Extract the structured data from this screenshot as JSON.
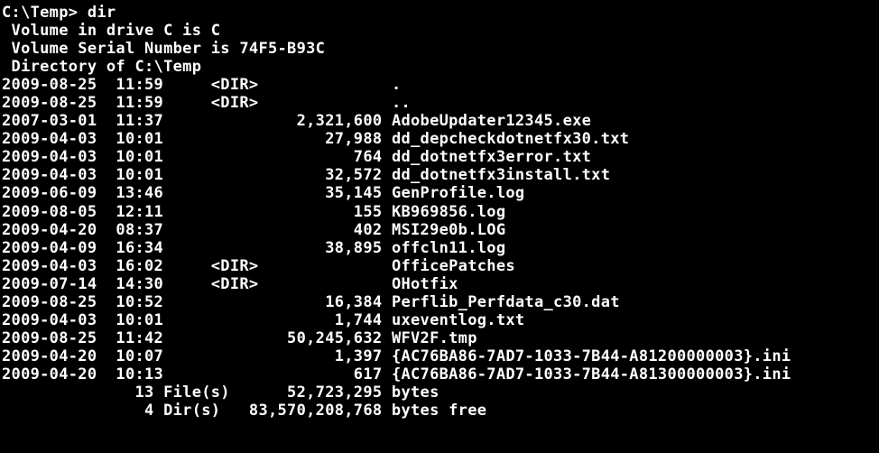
{
  "prompt": "C:\\Temp> dir",
  "vol_line": " Volume in drive C is C",
  "serial_line": " Volume Serial Number is 74F5-B93C",
  "dir_of_line": " Directory of C:\\Temp",
  "entries": [
    {
      "date": "2009-08-25",
      "time": "11:59",
      "dir": true,
      "size": "",
      "name": "."
    },
    {
      "date": "2009-08-25",
      "time": "11:59",
      "dir": true,
      "size": "",
      "name": ".."
    },
    {
      "date": "2007-03-01",
      "time": "11:37",
      "dir": false,
      "size": "2,321,600",
      "name": "AdobeUpdater12345.exe"
    },
    {
      "date": "2009-04-03",
      "time": "10:01",
      "dir": false,
      "size": "27,988",
      "name": "dd_depcheckdotnetfx30.txt"
    },
    {
      "date": "2009-04-03",
      "time": "10:01",
      "dir": false,
      "size": "764",
      "name": "dd_dotnetfx3error.txt"
    },
    {
      "date": "2009-04-03",
      "time": "10:01",
      "dir": false,
      "size": "32,572",
      "name": "dd_dotnetfx3install.txt"
    },
    {
      "date": "2009-06-09",
      "time": "13:46",
      "dir": false,
      "size": "35,145",
      "name": "GenProfile.log"
    },
    {
      "date": "2009-08-05",
      "time": "12:11",
      "dir": false,
      "size": "155",
      "name": "KB969856.log"
    },
    {
      "date": "2009-04-20",
      "time": "08:37",
      "dir": false,
      "size": "402",
      "name": "MSI29e0b.LOG"
    },
    {
      "date": "2009-04-09",
      "time": "16:34",
      "dir": false,
      "size": "38,895",
      "name": "offcln11.log"
    },
    {
      "date": "2009-04-03",
      "time": "16:02",
      "dir": true,
      "size": "",
      "name": "OfficePatches"
    },
    {
      "date": "2009-07-14",
      "time": "14:30",
      "dir": true,
      "size": "",
      "name": "OHotfix"
    },
    {
      "date": "2009-08-25",
      "time": "10:52",
      "dir": false,
      "size": "16,384",
      "name": "Perflib_Perfdata_c30.dat"
    },
    {
      "date": "2009-04-03",
      "time": "10:01",
      "dir": false,
      "size": "1,744",
      "name": "uxeventlog.txt"
    },
    {
      "date": "2009-08-25",
      "time": "11:42",
      "dir": false,
      "size": "50,245,632",
      "name": "WFV2F.tmp"
    },
    {
      "date": "2009-04-20",
      "time": "10:07",
      "dir": false,
      "size": "1,397",
      "name": "{AC76BA86-7AD7-1033-7B44-A81200000003}.ini"
    },
    {
      "date": "2009-04-20",
      "time": "10:13",
      "dir": false,
      "size": "617",
      "name": "{AC76BA86-7AD7-1033-7B44-A81300000003}.ini"
    }
  ],
  "summary": {
    "file_count": "13",
    "file_label": "File(s)",
    "file_bytes": "52,723,295",
    "file_bytes_label": "bytes",
    "dir_count": "4",
    "dir_label": "Dir(s)",
    "dir_bytes": "83,570,208,768",
    "dir_bytes_label": "bytes free"
  },
  "dir_tag": "<DIR>"
}
